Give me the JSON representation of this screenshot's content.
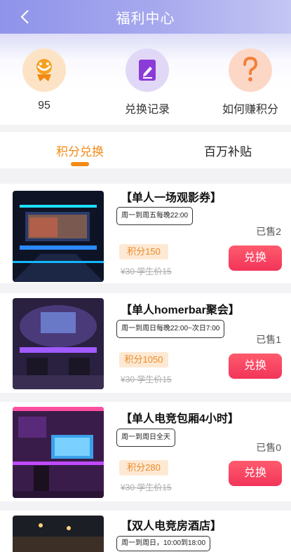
{
  "header": {
    "title": "福利中心",
    "back_icon": "chevron-left-icon"
  },
  "top": {
    "points_value": "95",
    "exchange_records_label": "兑换记录",
    "how_to_earn_label": "如何赚积分"
  },
  "tabs": [
    {
      "label": "积分兑换",
      "active": true
    },
    {
      "label": "百万补贴",
      "active": false
    }
  ],
  "products": [
    {
      "name": "【单人一场观影券】",
      "time": "周一到周五每晚22:00",
      "sold": "已售2",
      "points": "积分150",
      "price": "¥30   学生价15",
      "button": "兑换"
    },
    {
      "name": "【单人homerbar聚会】",
      "time": "周一到周日每晚22:00~次日7:00",
      "sold": "已售1",
      "points": "积分1050",
      "price": "¥30   学生价15",
      "button": "兑换"
    },
    {
      "name": "【单人电竞包厢4小时】",
      "time": "周一到周日全天",
      "sold": "已售0",
      "points": "积分280",
      "price": "¥30   学生价15",
      "button": "兑换"
    },
    {
      "name": "【双人电竞房酒店】",
      "time": "周一到周日，10:00到18:00",
      "sold": "",
      "points": "",
      "price": "",
      "button": ""
    }
  ],
  "colors": {
    "accent_orange": "#f28c18",
    "button_red": "#f2345a",
    "header_purple": "#9a9cec"
  }
}
